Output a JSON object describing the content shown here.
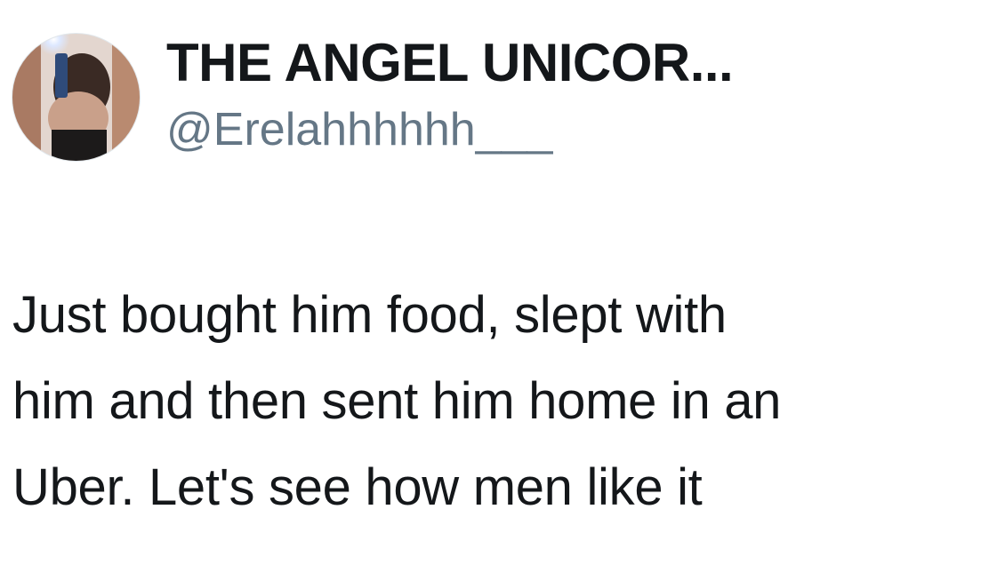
{
  "tweet": {
    "author": {
      "display_name": "THE ANGEL UNICOR...",
      "handle": "@Erelahhhhhh___",
      "avatar_icon": "profile-photo-avatar"
    },
    "text": "Just bought him food, slept with\nhim and then sent him home in an\nUber. Let's see how men like it"
  },
  "colors": {
    "text_primary": "#14171a",
    "text_secondary": "#657786",
    "background": "#ffffff"
  }
}
